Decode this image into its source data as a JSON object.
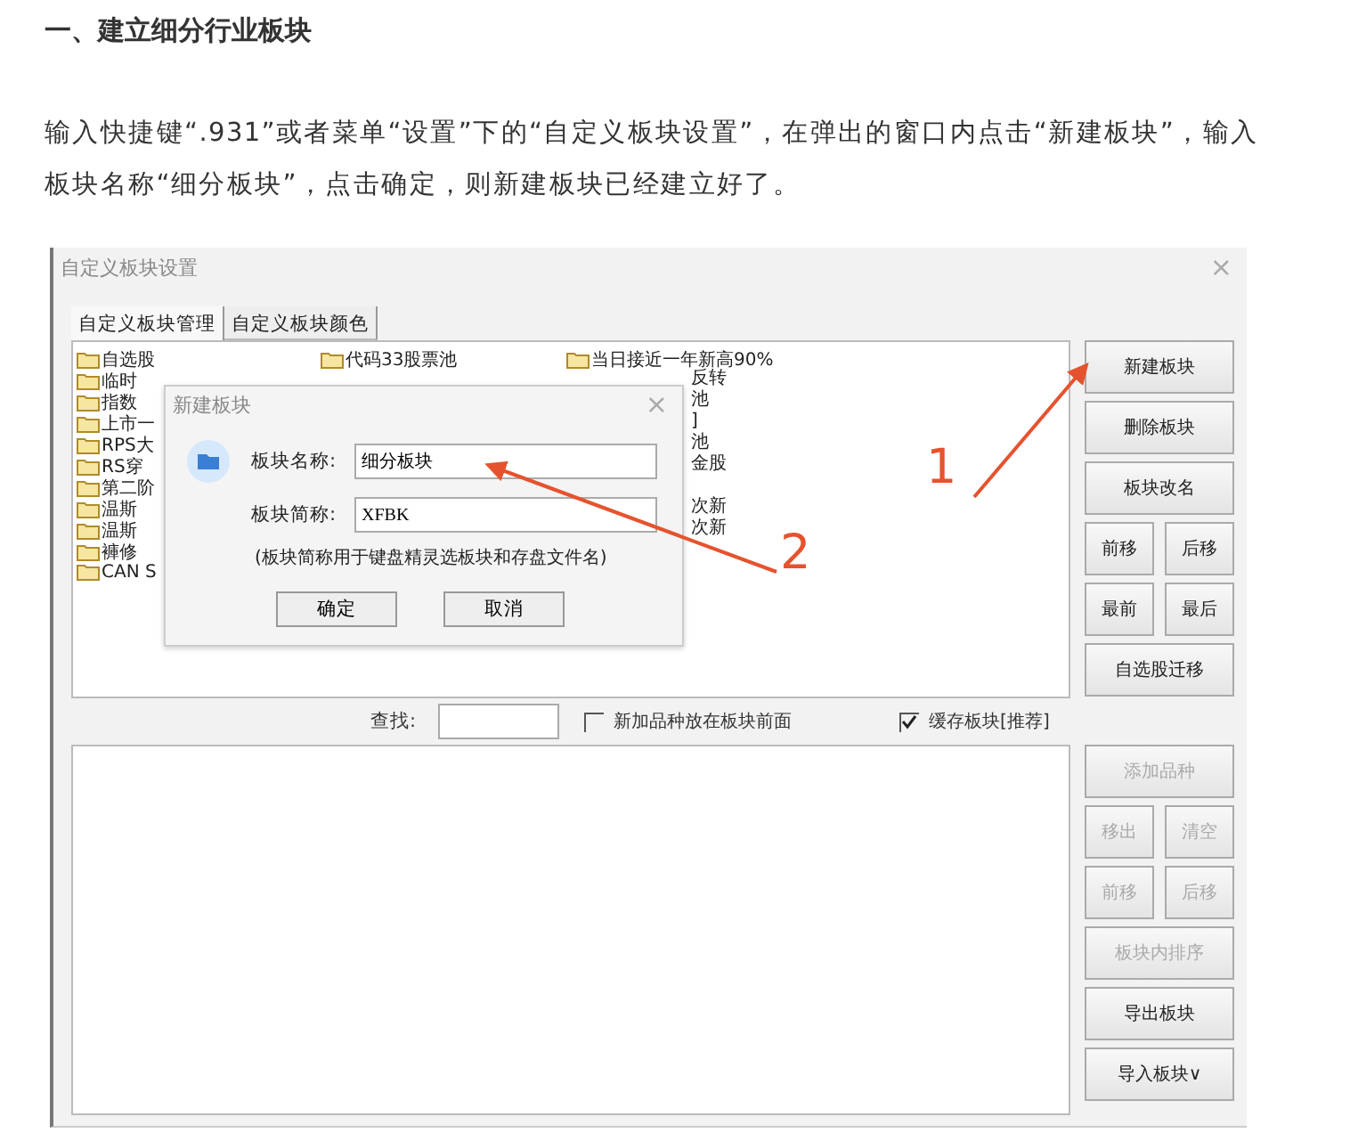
{
  "heading": "一、建立细分行业板块",
  "paragraph": "输入快捷键“.931”或者菜单“设置”下的“自定义板块设置”，在弹出的窗口内点击“新建板块”，输入板块名称“细分板块”，点击确定，则新建板块已经建立好了。",
  "window": {
    "title": "自定义板块设置",
    "close": "×",
    "tabs": [
      {
        "label": "自定义板块管理",
        "selected": true
      },
      {
        "label": "自定义板块颜色",
        "selected": false
      }
    ],
    "block_list": [
      [
        {
          "kind": "folder",
          "label": "自选股"
        },
        {
          "kind": "folder",
          "label": "代码33股票池"
        },
        {
          "kind": "folder",
          "label": "当日接近一年新高90%"
        }
      ],
      [
        {
          "kind": "folder",
          "label": "临时"
        },
        {
          "kind": "fragment",
          "label": "反转"
        }
      ],
      [
        {
          "kind": "folder",
          "label": "指数"
        },
        {
          "kind": "fragment",
          "label": "池"
        }
      ],
      [
        {
          "kind": "folder",
          "label": "上市一"
        },
        {
          "kind": "fragment",
          "label": "]"
        }
      ],
      [
        {
          "kind": "folder",
          "label": "RPS大"
        },
        {
          "kind": "fragment",
          "label": "池"
        }
      ],
      [
        {
          "kind": "folder",
          "label": "RS穿"
        },
        {
          "kind": "fragment",
          "label": "金股"
        }
      ],
      [
        {
          "kind": "folder",
          "label": "第二阶"
        }
      ],
      [
        {
          "kind": "folder",
          "label": "温斯"
        },
        {
          "kind": "fragment",
          "label": "次新"
        }
      ],
      [
        {
          "kind": "folder",
          "label": "温斯"
        },
        {
          "kind": "fragment",
          "label": "次新"
        }
      ],
      [
        {
          "kind": "folder",
          "label": "褲修"
        }
      ],
      [
        {
          "kind": "folder",
          "label": "CAN S"
        }
      ]
    ],
    "block_buttons": [
      [
        {
          "label": "新建板块",
          "disabled": false
        }
      ],
      [
        {
          "label": "删除板块",
          "disabled": false
        }
      ],
      [
        {
          "label": "板块改名",
          "disabled": false
        }
      ],
      [
        {
          "label": "前移",
          "disabled": false
        },
        {
          "label": "后移",
          "disabled": false
        }
      ],
      [
        {
          "label": "最前",
          "disabled": false
        },
        {
          "label": "最后",
          "disabled": false
        }
      ],
      [
        {
          "label": "自选股迁移",
          "disabled": false
        }
      ]
    ],
    "search_label": "查找:",
    "options": [
      {
        "label": "新加品种放在板块前面",
        "checked": false
      },
      {
        "label": "缓存板块[推荐]",
        "checked": true
      }
    ],
    "stock_buttons": [
      [
        {
          "label": "添加品种",
          "disabled": true
        }
      ],
      [
        {
          "label": "移出",
          "disabled": true
        },
        {
          "label": "清空",
          "disabled": true
        }
      ],
      [
        {
          "label": "前移",
          "disabled": true
        },
        {
          "label": "后移",
          "disabled": true
        }
      ],
      [
        {
          "label": "板块内排序",
          "disabled": true
        }
      ],
      [
        {
          "label": "导出板块",
          "disabled": false
        }
      ],
      [
        {
          "label": "导入板块∨",
          "disabled": false
        }
      ]
    ]
  },
  "dialog": {
    "title": "新建板块",
    "close": "×",
    "fields": [
      {
        "label": "板块名称:",
        "value": "细分板块"
      },
      {
        "label": "板块简称:",
        "value": "XFBK"
      }
    ],
    "note": "(板块简称用于键盘精灵选板块和存盘文件名)",
    "buttons": [
      "确定",
      "取消"
    ]
  },
  "annotations": [
    "1",
    "2"
  ]
}
